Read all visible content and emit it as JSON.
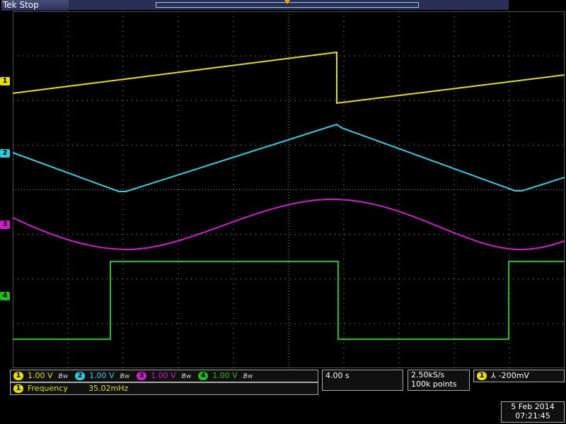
{
  "header": {
    "brand": "Tek",
    "status": "Stop"
  },
  "colors": {
    "ch1": "#e6e000",
    "ch2": "#2ccfe0",
    "ch3": "#d21cd2",
    "ch4": "#18c218",
    "grid": "#9a9a9a"
  },
  "channels": [
    {
      "label": "1",
      "scale": "1.00 V"
    },
    {
      "label": "2",
      "scale": "1.00 V"
    },
    {
      "label": "3",
      "scale": "1.00 V"
    },
    {
      "label": "4",
      "scale": "1.00 V"
    }
  ],
  "bandwidth_glyph": "B̸w",
  "measurement": {
    "channel": "1",
    "name": "Frequency",
    "value": "35.02mHz"
  },
  "timebase": {
    "scale": "4.00 s"
  },
  "acquisition": {
    "sample_rate": "2.50kS/s",
    "record_length": "100k points"
  },
  "trigger": {
    "channel": "1",
    "slope_glyph": "⅄",
    "level": "-200mV"
  },
  "datetime": {
    "date": "5 Feb 2014",
    "time": "07:21:45"
  }
}
